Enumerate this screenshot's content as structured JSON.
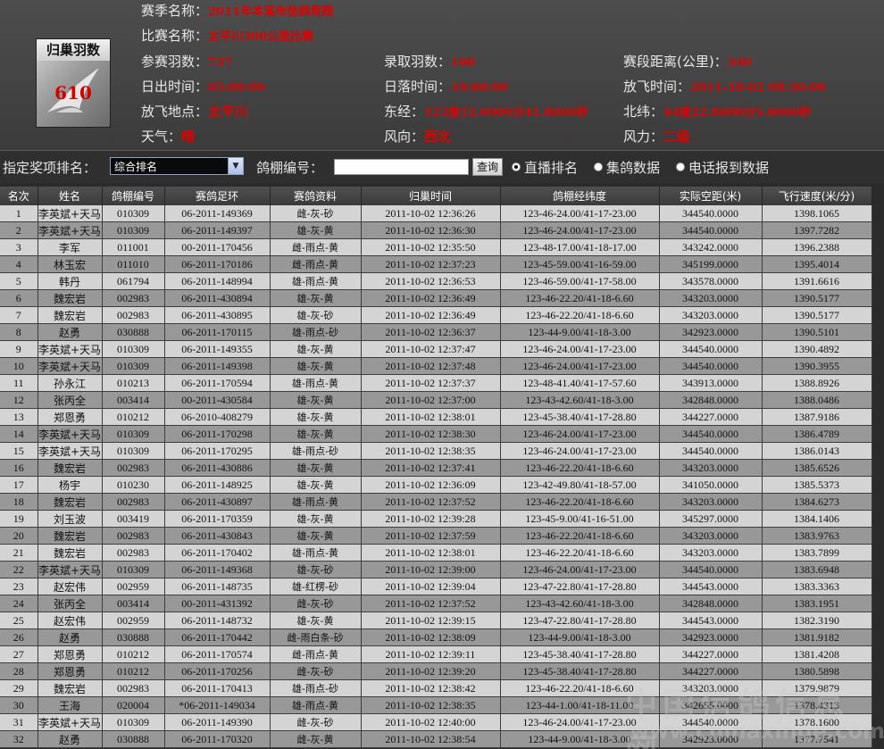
{
  "badge": {
    "title": "归巢羽数",
    "count": "610"
  },
  "info": {
    "season_label": "赛季名称：",
    "season_value": "2011年本溪市信鸽竞翔",
    "race_label": "比赛名称：",
    "race_value": "太平川300公里比赛",
    "entries_label": "参赛羽数：",
    "entries_value": "737",
    "prizes_label": "录取羽数：",
    "prizes_value": "100",
    "distance_label": "赛段距离(公里)：",
    "distance_value": "340",
    "sunrise_label": "日出时间：",
    "sunrise_value": "05:00:00",
    "sunset_label": "日落时间：",
    "sunset_value": "19:00:00",
    "release_label": "放飞时间：",
    "release_value": "2011-10-02 08:30:00",
    "place_label": "放飞地点：",
    "place_value": "太平川",
    "lng_label": "东经：",
    "lng_value": "123度12.0000分41.8000秒",
    "lat_label": "北纬：",
    "lat_value": "44度22.0000分5.0000秒",
    "weather_label": "天气：",
    "weather_value": "晴",
    "wind_dir_label": "风向：",
    "wind_dir_value": "西北",
    "wind_force_label": "风力：",
    "wind_force_value": "二级"
  },
  "filter": {
    "award_label": "指定奖项排名：",
    "award_selected": "综合排名",
    "loft_label": "鸽棚编号：",
    "loft_value": "",
    "query_button": "查询",
    "radio_live": "直播排名",
    "radio_gather": "集鸽数据",
    "radio_phone": "电话报到数据"
  },
  "table": {
    "headers": [
      "名次",
      "姓名",
      "鸽棚编号",
      "赛鸽足环",
      "赛鸽资料",
      "归巢时间",
      "鸽棚经纬度",
      "实际空距(米)",
      "飞行速度(米/分)"
    ],
    "rows": [
      [
        "1",
        "李英斌+天马",
        "010309",
        "06-2011-149369",
        "雌-灰-砂",
        "2011-10-02 12:36:26",
        "123-46-24.00/41-17-23.00",
        "344540.0000",
        "1398.1065"
      ],
      [
        "2",
        "李英斌+天马",
        "010309",
        "06-2011-149397",
        "雄-灰-黄",
        "2011-10-02 12:36:30",
        "123-46-24.00/41-17-23.00",
        "344540.0000",
        "1397.7282"
      ],
      [
        "3",
        "李军",
        "011001",
        "00-2011-170456",
        "雌-雨点-黄",
        "2011-10-02 12:35:50",
        "123-48-17.00/41-18-17.00",
        "343242.0000",
        "1396.2388"
      ],
      [
        "4",
        "林玉宏",
        "011010",
        "06-2011-170186",
        "雌-雨点-黄",
        "2011-10-02 12:37:23",
        "123-45-59.00/41-16-59.00",
        "345199.0000",
        "1395.4014"
      ],
      [
        "5",
        "韩丹",
        "061794",
        "06-2011-148994",
        "雄-雨点-黄",
        "2011-10-02 12:36:53",
        "123-46-59.00/41-17-58.00",
        "343578.0000",
        "1391.6616"
      ],
      [
        "6",
        "魏宏岩",
        "002983",
        "06-2011-430894",
        "雄-灰-黄",
        "2011-10-02 12:36:49",
        "123-46-22.20/41-18-6.60",
        "343203.0000",
        "1390.5177"
      ],
      [
        "7",
        "魏宏岩",
        "002983",
        "06-2011-430895",
        "雄-灰-砂",
        "2011-10-02 12:36:49",
        "123-46-22.20/41-18-6.60",
        "343203.0000",
        "1390.5177"
      ],
      [
        "8",
        "赵勇",
        "030888",
        "06-2011-170115",
        "雄-雨点-砂",
        "2011-10-02 12:36:37",
        "123-44-9.00/41-18-3.00",
        "342923.0000",
        "1390.5101"
      ],
      [
        "9",
        "李英斌+天马",
        "010309",
        "06-2011-149355",
        "雄-灰-黄",
        "2011-10-02 12:37:47",
        "123-46-24.00/41-17-23.00",
        "344540.0000",
        "1390.4892"
      ],
      [
        "10",
        "李英斌+天马",
        "010309",
        "06-2011-149398",
        "雄-灰-黄",
        "2011-10-02 12:37:48",
        "123-46-24.00/41-17-23.00",
        "344540.0000",
        "1390.3955"
      ],
      [
        "11",
        "孙永江",
        "010213",
        "06-2011-170594",
        "雄-雨点-黄",
        "2011-10-02 12:37:37",
        "123-48-41.40/41-17-57.60",
        "343913.0000",
        "1388.8926"
      ],
      [
        "12",
        "张丙全",
        "003414",
        "00-2011-430584",
        "雄-灰-黄",
        "2011-10-02 12:37:00",
        "123-43-42.60/41-18-3.00",
        "342848.0000",
        "1388.0486"
      ],
      [
        "13",
        "郑恩勇",
        "010212",
        "06-2010-408279",
        "雄-灰-黄",
        "2011-10-02 12:38:01",
        "123-45-38.40/41-17-28.80",
        "344227.0000",
        "1387.9186"
      ],
      [
        "14",
        "李英斌+天马",
        "010309",
        "06-2011-170298",
        "雄-灰-黄",
        "2011-10-02 12:38:30",
        "123-46-24.00/41-17-23.00",
        "344540.0000",
        "1386.4789"
      ],
      [
        "15",
        "李英斌+天马",
        "010309",
        "06-2011-170295",
        "雄-雨点-砂",
        "2011-10-02 12:38:35",
        "123-46-24.00/41-17-23.00",
        "344540.0000",
        "1386.0143"
      ],
      [
        "16",
        "魏宏岩",
        "002983",
        "06-2011-430886",
        "雄-灰-黄",
        "2011-10-02 12:37:41",
        "123-46-22.20/41-18-6.60",
        "343203.0000",
        "1385.6526"
      ],
      [
        "17",
        "杨宇",
        "010230",
        "06-2011-148925",
        "雄-灰-黄",
        "2011-10-02 12:36:09",
        "123-42-49.80/41-18-57.00",
        "341050.0000",
        "1385.5373"
      ],
      [
        "18",
        "魏宏岩",
        "002983",
        "06-2011-430897",
        "雄-雨点-黄",
        "2011-10-02 12:37:52",
        "123-46-22.20/41-18-6.60",
        "343203.0000",
        "1384.6273"
      ],
      [
        "19",
        "刘玉波",
        "003419",
        "06-2011-170359",
        "雄-灰-黄",
        "2011-10-02 12:39:28",
        "123-45-9.00/41-16-51.00",
        "345297.0000",
        "1384.1406"
      ],
      [
        "20",
        "魏宏岩",
        "002983",
        "06-2011-430843",
        "雄-灰-黄",
        "2011-10-02 12:37:59",
        "123-46-22.20/41-18-6.60",
        "343203.0000",
        "1383.9763"
      ],
      [
        "21",
        "魏宏岩",
        "002983",
        "06-2011-170402",
        "雄-雨点-黄",
        "2011-10-02 12:38:01",
        "123-46-22.20/41-18-6.60",
        "343203.0000",
        "1383.7899"
      ],
      [
        "22",
        "李英斌+天马",
        "010309",
        "06-2011-149368",
        "雄-灰-砂",
        "2011-10-02 12:39:00",
        "123-46-24.00/41-17-23.00",
        "344540.0000",
        "1383.6948"
      ],
      [
        "23",
        "赵宏伟",
        "002959",
        "06-2011-148735",
        "雄-红楞-砂",
        "2011-10-02 12:39:04",
        "123-47-22.80/41-17-28.80",
        "344543.0000",
        "1383.3363"
      ],
      [
        "24",
        "张丙全",
        "003414",
        "00-2011-431392",
        "雌-灰-砂",
        "2011-10-02 12:37:52",
        "123-43-42.60/41-18-3.00",
        "342848.0000",
        "1383.1951"
      ],
      [
        "25",
        "赵宏伟",
        "002959",
        "06-2011-148732",
        "雄-灰-黄",
        "2011-10-02 12:39:15",
        "123-47-22.80/41-17-28.80",
        "344543.0000",
        "1382.3190"
      ],
      [
        "26",
        "赵勇",
        "030888",
        "06-2011-170442",
        "雌-雨白条-砂",
        "2011-10-02 12:38:09",
        "123-44-9.00/41-18-3.00",
        "342923.0000",
        "1381.9182"
      ],
      [
        "27",
        "郑恩勇",
        "010212",
        "06-2011-170574",
        "雌-雨点-黄",
        "2011-10-02 12:39:11",
        "123-45-38.40/41-17-28.80",
        "344227.0000",
        "1381.4208"
      ],
      [
        "28",
        "郑恩勇",
        "010212",
        "06-2011-170256",
        "雌-灰-砂",
        "2011-10-02 12:39:20",
        "123-45-38.40/41-17-28.80",
        "344227.0000",
        "1380.5898"
      ],
      [
        "29",
        "魏宏岩",
        "002983",
        "06-2011-170413",
        "雄-雨点-砂",
        "2011-10-02 12:38:42",
        "123-46-22.20/41-18-6.60",
        "343203.0000",
        "1379.9879"
      ],
      [
        "30",
        "王海",
        "020004",
        "*06-2011-149034",
        "雄-雨点-黄",
        "2011-10-02 12:38:35",
        "123-44-1.00/41-18-11.00",
        "342655.0000",
        "1378.4313"
      ],
      [
        "31",
        "李英斌+天马",
        "010309",
        "06-2011-149390",
        "雌-灰-砂",
        "2011-10-02 12:40:00",
        "123-46-24.00/41-17-23.00",
        "344540.0000",
        "1378.1600"
      ],
      [
        "32",
        "赵勇",
        "030888",
        "06-2011-170320",
        "雌-灰-黄",
        "2011-10-02 12:38:54",
        "123-44-9.00/41-18-3.00",
        "342923.0000",
        "1377.7541"
      ]
    ]
  },
  "watermark": {
    "line1": "中国信鸽信息网",
    "line2": "www.chinaxinge.com"
  }
}
